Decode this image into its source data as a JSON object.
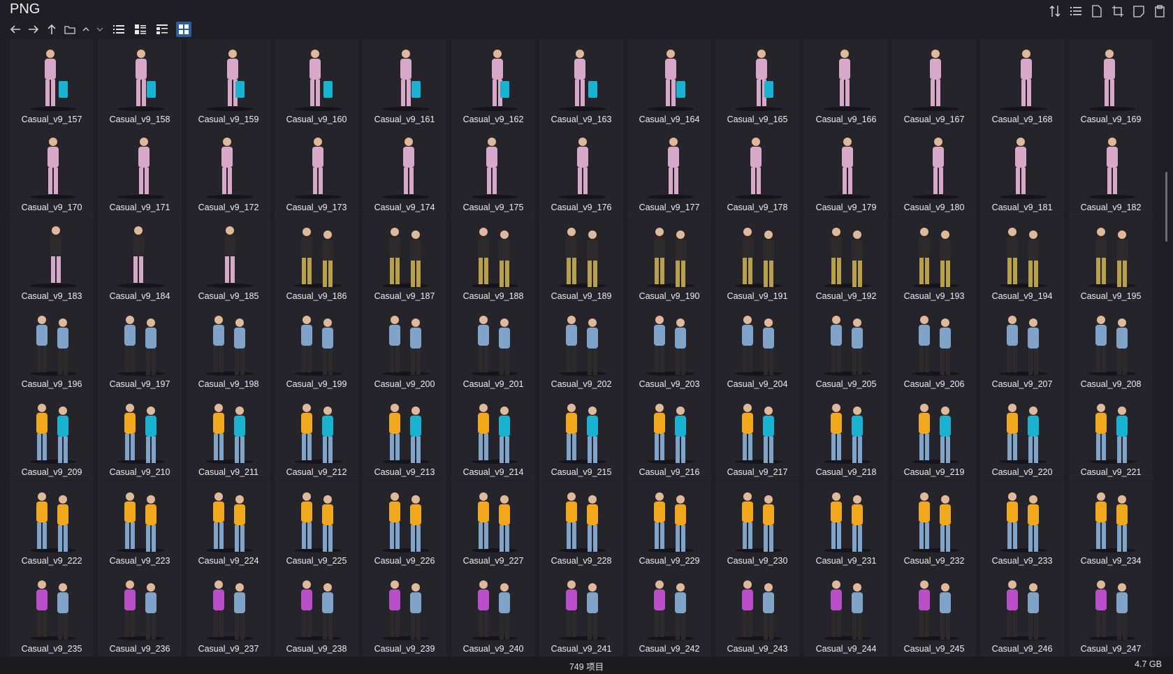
{
  "window": {
    "title": "PNG"
  },
  "toolbar": {
    "back_icon": "arrow-left-icon",
    "forward_icon": "arrow-right-icon",
    "up_icon": "arrow-up-icon",
    "view_modes": [
      "details-view",
      "list-view",
      "tree-view",
      "thumbnail-view"
    ],
    "active_view": "thumbnail-view",
    "right_icons": [
      "sort-icon",
      "list-icon",
      "file-icon",
      "crop-icon",
      "panel-icon",
      "clipboard-icon"
    ]
  },
  "files": [
    "Casual_v9_157",
    "Casual_v9_158",
    "Casual_v9_159",
    "Casual_v9_160",
    "Casual_v9_161",
    "Casual_v9_162",
    "Casual_v9_163",
    "Casual_v9_164",
    "Casual_v9_165",
    "Casual_v9_166",
    "Casual_v9_167",
    "Casual_v9_168",
    "Casual_v9_169",
    "Casual_v9_170",
    "Casual_v9_171",
    "Casual_v9_172",
    "Casual_v9_173",
    "Casual_v9_174",
    "Casual_v9_175",
    "Casual_v9_176",
    "Casual_v9_177",
    "Casual_v9_178",
    "Casual_v9_179",
    "Casual_v9_180",
    "Casual_v9_181",
    "Casual_v9_182",
    "Casual_v9_183",
    "Casual_v9_184",
    "Casual_v9_185",
    "Casual_v9_186",
    "Casual_v9_187",
    "Casual_v9_188",
    "Casual_v9_189",
    "Casual_v9_190",
    "Casual_v9_191",
    "Casual_v9_192",
    "Casual_v9_193",
    "Casual_v9_194",
    "Casual_v9_195",
    "Casual_v9_196",
    "Casual_v9_197",
    "Casual_v9_198",
    "Casual_v9_199",
    "Casual_v9_200",
    "Casual_v9_201",
    "Casual_v9_202",
    "Casual_v9_203",
    "Casual_v9_204",
    "Casual_v9_205",
    "Casual_v9_206",
    "Casual_v9_207",
    "Casual_v9_208",
    "Casual_v9_209",
    "Casual_v9_210",
    "Casual_v9_211",
    "Casual_v9_212",
    "Casual_v9_213",
    "Casual_v9_214",
    "Casual_v9_215",
    "Casual_v9_216",
    "Casual_v9_217",
    "Casual_v9_218",
    "Casual_v9_219",
    "Casual_v9_220",
    "Casual_v9_221",
    "Casual_v9_222",
    "Casual_v9_223",
    "Casual_v9_224",
    "Casual_v9_225",
    "Casual_v9_226",
    "Casual_v9_227",
    "Casual_v9_228",
    "Casual_v9_229",
    "Casual_v9_230",
    "Casual_v9_231",
    "Casual_v9_232",
    "Casual_v9_233",
    "Casual_v9_234",
    "Casual_v9_235",
    "Casual_v9_236",
    "Casual_v9_237",
    "Casual_v9_238",
    "Casual_v9_239",
    "Casual_v9_240",
    "Casual_v9_241",
    "Casual_v9_242",
    "Casual_v9_243",
    "Casual_v9_244",
    "Casual_v9_245",
    "Casual_v9_246",
    "Casual_v9_247"
  ],
  "colors": {
    "background": "#1f1e24",
    "tile_bg": "#25242b",
    "active_view_bg": "#2e5d9a",
    "figure_pink": "#d8a8c8",
    "figure_skin": "#e0b89a",
    "suitcase": "#19b3d1",
    "yellow_hoodie": "#f2a81c",
    "denim": "#7fa3c9",
    "purple_top": "#b84fc9",
    "dark_jacket": "#2c2a2a"
  },
  "status": {
    "item_count": "749 项目",
    "total_size": "4.7 GB"
  }
}
